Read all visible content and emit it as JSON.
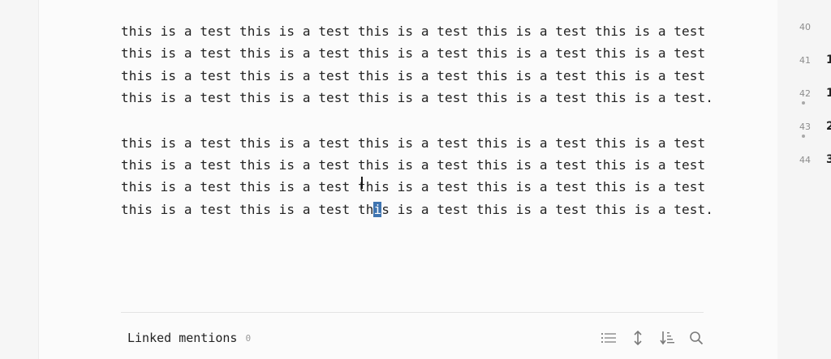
{
  "editor": {
    "paragraphs": [
      {
        "lines": [
          "this is a test this is a test this is a test this is a test this is a test",
          "this is a test this is a test this is a test this is a test this is a test",
          "this is a test this is a test this is a test this is a test this is a test",
          "this is a test this is a test this is a test this is a test this is a test."
        ]
      },
      {
        "lines": [
          "this is a test this is a test this is a test this is a test this is a test",
          "this is a test this is a test this is a test this is a test this is a test",
          "this is a test this is a test this is a test this is a test this is a test"
        ],
        "last_line": {
          "before": "this is a test this is a test th",
          "selected": "i",
          "after": "s is a test this is a test this is a test."
        }
      }
    ]
  },
  "linked_mentions": {
    "title": "Linked mentions",
    "count": "0"
  },
  "toolbar": {
    "icons": [
      "list-icon",
      "collapse-expand-icon",
      "sort-icon",
      "search-icon"
    ]
  },
  "outline": {
    "rows": [
      {
        "num": "40",
        "peek": "",
        "dot": false
      },
      {
        "num": "41",
        "peek": "1",
        "dot": false
      },
      {
        "num": "42",
        "peek": "1",
        "dot": true
      },
      {
        "num": "43",
        "peek": "2",
        "dot": true
      },
      {
        "num": "44",
        "peek": "3",
        "dot": false
      }
    ]
  }
}
